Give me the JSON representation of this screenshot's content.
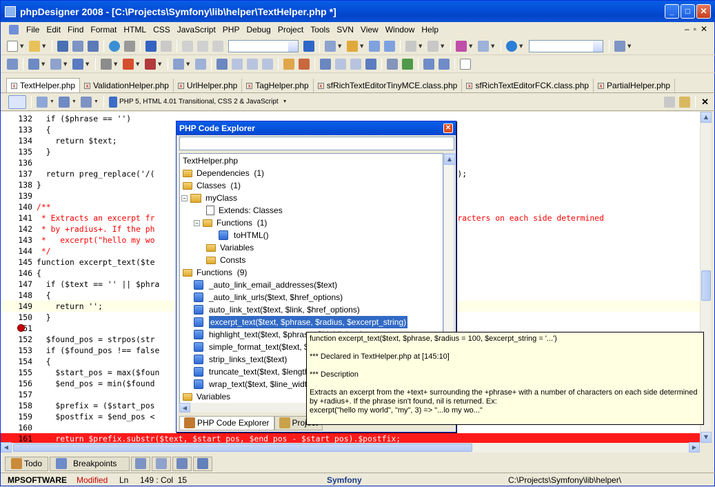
{
  "window": {
    "title": "phpDesigner 2008 - [C:\\Projects\\Symfony\\lib\\helper\\TextHelper.php *]"
  },
  "menu": [
    "File",
    "Edit",
    "Find",
    "Format",
    "HTML",
    "CSS",
    "JavaScript",
    "PHP",
    "Debug",
    "Project",
    "Tools",
    "SVN",
    "View",
    "Window",
    "Help"
  ],
  "tabs": [
    "TextHelper.php",
    "ValidationHelper.php",
    "UrlHelper.php",
    "TagHelper.php",
    "sfRichTextEditorTinyMCE.class.php",
    "sfRichTextEditorFCK.class.php",
    "PartialHelper.php"
  ],
  "doc_toolbar": {
    "syntax": "PHP 5, HTML 4.01 Transitional, CSS 2 & JavaScript"
  },
  "code_lines": [
    {
      "n": "132",
      "t": "  if ($phrase == '')"
    },
    {
      "n": "133",
      "t": "  {"
    },
    {
      "n": "134",
      "t": "    return $text;"
    },
    {
      "n": "135",
      "t": "  }"
    },
    {
      "n": "136",
      "t": ""
    },
    {
      "n": "137",
      "t": "  return preg_replace('/(                                                              xt);"
    },
    {
      "n": "138",
      "t": "}"
    },
    {
      "n": "139",
      "t": ""
    },
    {
      "n": "140",
      "t": "/**"
    },
    {
      "n": "141",
      "t": " * Extracts an excerpt fr                                                        r of characters on each side determined"
    },
    {
      "n": "142",
      "t": " * by +radius+. If the ph"
    },
    {
      "n": "143",
      "t": " *   excerpt(\"hello my wo"
    },
    {
      "n": "144",
      "t": " */"
    },
    {
      "n": "145",
      "t": "function excerpt_text($te                                                             )"
    },
    {
      "n": "146",
      "t": "{"
    },
    {
      "n": "147",
      "t": "  if ($text == '' || $phra"
    },
    {
      "n": "148",
      "t": "  {"
    },
    {
      "n": "149",
      "t": "    return '';"
    },
    {
      "n": "150",
      "t": "  }"
    },
    {
      "n": "151",
      "t": ""
    },
    {
      "n": "152",
      "t": "  $found_pos = strpos(str"
    },
    {
      "n": "153",
      "t": "  if ($found_pos !== false"
    },
    {
      "n": "154",
      "t": "  {"
    },
    {
      "n": "155",
      "t": "    $start_pos = max($foun"
    },
    {
      "n": "156",
      "t": "    $end_pos = min($found"
    },
    {
      "n": "157",
      "t": ""
    },
    {
      "n": "158",
      "t": "    $prefix = ($start_pos"
    },
    {
      "n": "159",
      "t": "    $postfix = $end_pos <"
    },
    {
      "n": "160",
      "t": ""
    },
    {
      "n": "161",
      "t": "    return $prefix.substr($text, $start_pos, $end_pos - $start_pos).$postfix;"
    }
  ],
  "explorer": {
    "title": "PHP Code Explorer",
    "file": "TextHelper.php",
    "dependencies": "Dependencies  (1)",
    "classes": "Classes  (1)",
    "myclass": "myClass",
    "extends": "Extends: Classes",
    "functions_class": "Functions  (1)",
    "tohtml": "toHTML()",
    "variables_class": "Variables",
    "consts": "Consts",
    "functions": "Functions  (9)",
    "fn_items": [
      "_auto_link_email_addresses($text)",
      "_auto_link_urls($text, $href_options)",
      "auto_link_text($text, $link, $href_options)",
      "excerpt_text($text, $phrase, $radius, $excerpt_string)",
      "highlight_text($text, $phrase, $highlighter)",
      "simple_format_text($text, $options)",
      "strip_links_text($text)",
      "truncate_text($text, $length, $truncate_string)",
      "wrap_text($text, $line_width)"
    ],
    "variables": "Variables",
    "tab_explorer": "PHP Code Explorer",
    "tab_project": "Project"
  },
  "tooltip": {
    "signature": "function excerpt_text($text, $phrase, $radius = 100, $excerpt_string = '...')",
    "declared": "*** Declared in TextHelper.php at [145:10]",
    "desc_head": "*** Description",
    "desc1": "Extracts an excerpt from the +text+ surrounding the +phrase+ with a number of characters on each side determined",
    "desc2": "by +radius+. If the phrase isn't found, nil is returned. Ex:",
    "desc3": "excerpt(\"hello my world\", \"my\", 3) => \"...lo my wo...\""
  },
  "bottom_tabs": {
    "todo": "Todo",
    "breakpoints": "Breakpoints"
  },
  "status": {
    "company": "MPSOFTWARE",
    "modified": "Modified",
    "position": "Ln     149 : Col  15",
    "project": "Symfony",
    "path": "C:\\Projects\\Symfony\\lib\\helper\\"
  }
}
